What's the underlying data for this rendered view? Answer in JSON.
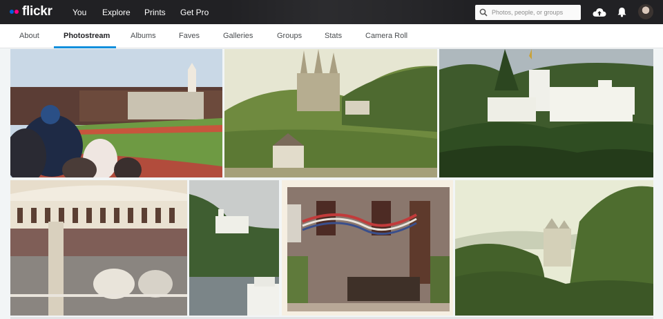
{
  "brand": {
    "name": "flickr",
    "blue": "#0063dc",
    "pink": "#ff0084"
  },
  "top_nav": {
    "you": "You",
    "explore": "Explore",
    "prints": "Prints",
    "get_pro": "Get Pro"
  },
  "search": {
    "placeholder": "Photos, people, or groups",
    "icon": "search-icon"
  },
  "header_icons": [
    "upload-cloud-icon",
    "notification-bell-icon",
    "avatar"
  ],
  "tabs": [
    {
      "label": "About"
    },
    {
      "label": "Photostream",
      "active": true
    },
    {
      "label": "Albums"
    },
    {
      "label": "Faves"
    },
    {
      "label": "Galleries"
    },
    {
      "label": "Groups"
    },
    {
      "label": "Stats"
    },
    {
      "label": "Camera Roll"
    }
  ],
  "accent_color": "#128fdc",
  "photos": [
    {
      "subject": "stadium-crowd-track"
    },
    {
      "subject": "gothic-church-hillside"
    },
    {
      "subject": "white-castle-trees"
    },
    {
      "subject": "carousel"
    },
    {
      "subject": "castle-river-boat"
    },
    {
      "subject": "brick-house-bunting"
    },
    {
      "subject": "castle-valley-view"
    }
  ]
}
